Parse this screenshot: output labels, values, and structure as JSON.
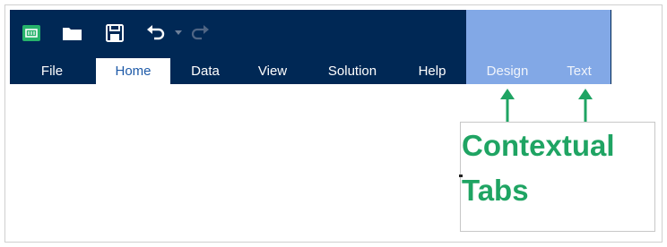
{
  "colors": {
    "ribbon": "#002855",
    "contextual_band": "#82a8e6",
    "active_tab_text": "#1e5aa8",
    "callout_text": "#1fa463"
  },
  "quick_access": [
    {
      "name": "app-logo-icon"
    },
    {
      "name": "open-folder-icon"
    },
    {
      "name": "save-icon"
    },
    {
      "name": "undo-icon"
    },
    {
      "name": "undo-dropdown-icon"
    },
    {
      "name": "redo-icon"
    }
  ],
  "tabs": {
    "file": "File",
    "home": "Home",
    "data": "Data",
    "view": "View",
    "solution": "Solution",
    "help": "Help",
    "design": "Design",
    "text": "Text"
  },
  "active_tab": "Home",
  "callout": {
    "line1": "Contextual",
    "line2": "Tabs"
  }
}
